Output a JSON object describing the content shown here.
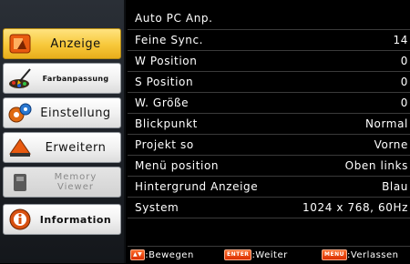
{
  "sidebar": {
    "items": [
      {
        "label": "Anzeige",
        "icon": "display-settings-icon",
        "state": "active"
      },
      {
        "label": "Farbanpassung",
        "icon": "paintbrush-icon",
        "state": "normal"
      },
      {
        "label": "Einstellung",
        "icon": "gears-icon",
        "state": "normal"
      },
      {
        "label": "Erweitern",
        "icon": "expand-arrow-icon",
        "state": "normal"
      },
      {
        "label": "Memory Viewer",
        "icon": "memory-stick-icon",
        "state": "disabled"
      },
      {
        "label": "Information",
        "icon": "info-icon",
        "state": "normal"
      }
    ]
  },
  "menu": {
    "rows": [
      {
        "label": "Auto PC Anp.",
        "value": ""
      },
      {
        "label": "Feine Sync.",
        "value": "14"
      },
      {
        "label": "W Position",
        "value": "0"
      },
      {
        "label": "S Position",
        "value": "0"
      },
      {
        "label": "W. Größe",
        "value": "0"
      },
      {
        "label": "Blickpunkt",
        "value": "Normal"
      },
      {
        "label": "Projekt so",
        "value": "Vorne"
      },
      {
        "label": "Menü position",
        "value": "Oben links"
      },
      {
        "label": "Hintergrund Anzeige",
        "value": "Blau"
      },
      {
        "label": "System",
        "value": "1024 x 768, 60Hz"
      }
    ]
  },
  "footer": {
    "move_key": "▲▼",
    "move_label": ":Bewegen",
    "enter_key": "ENTER",
    "enter_label": ":Weiter",
    "menu_key": "MENU",
    "menu_label": ":Verlassen"
  },
  "colors": {
    "active_button": "#f7c83a",
    "key_badge": "#e04010",
    "menu_bg": "#000000",
    "text": "#ffffff"
  }
}
